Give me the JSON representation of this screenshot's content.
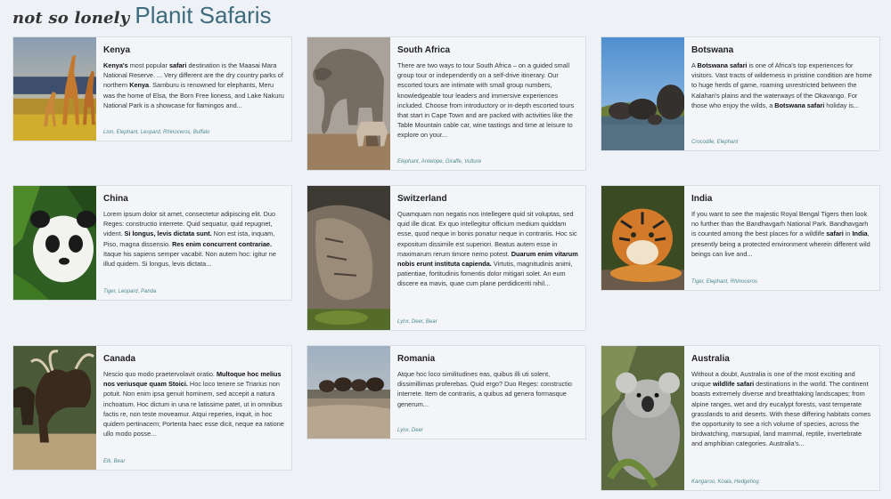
{
  "brand": {
    "tagline": "not so lonely",
    "name": "Planit Safaris"
  },
  "cards": [
    {
      "title": "Kenya",
      "parts": [
        {
          "b": true,
          "t": "Kenya's"
        },
        {
          "t": " most popular "
        },
        {
          "b": true,
          "t": "safari"
        },
        {
          "t": " destination is the Maasai Mara National Reserve. ... Very different are the dry country parks of northern "
        },
        {
          "b": true,
          "t": "Kenya"
        },
        {
          "t": ". Samburu is renowned for elephants, Meru was the home of Elsa, the Born Free lioness, and Lake Nakuru National Park is a showcase for flamingos and..."
        }
      ],
      "tags": "Lion, Elephant, Leopard, Rhinoceros, Buffalo",
      "image": "giraffe-photo"
    },
    {
      "title": "South Africa",
      "parts": [
        {
          "t": "There are two ways to tour South Africa – on a guided small group tour or independently on a self-drive itinerary. Our escorted tours are intimate with small group numbers, knowledgeable tour leaders and immersive experiences included. Choose from introductory or in-depth escorted tours that start in Cape Town and are packed with activities like the Table Mountain cable car, wine tastings and time at leisure to explore on your..."
        }
      ],
      "tags": "Elephant, Antelope, Giraffe, Vulture",
      "image": "elephant-photo"
    },
    {
      "title": "Botswana",
      "parts": [
        {
          "t": "A "
        },
        {
          "b": true,
          "t": "Botswana safari"
        },
        {
          "t": " is one of Africa's top experiences for visitors. Vast tracts of wilderness in pristine condition are home to huge herds of game, roaming unrestricted between the Kalahari's plains and the waterways of the Okavango. For those who enjoy the wilds, a "
        },
        {
          "b": true,
          "t": "Botswana safari"
        },
        {
          "t": " holiday is..."
        }
      ],
      "tags": "Crocodile, Elephant",
      "image": "elephant-herd-photo"
    },
    {
      "title": "China",
      "parts": [
        {
          "t": "Lorem ipsum dolor sit amet, consectetur adipiscing elit. Duo Reges: constructio interrete. Quid sequatur, quid repugnet, vident. "
        },
        {
          "b": true,
          "t": "Si longus, levis dictata sunt."
        },
        {
          "t": " Non est ista, inquam, Piso, magna dissensio. "
        },
        {
          "b": true,
          "t": "Res enim concurrent contrariae."
        },
        {
          "t": " Itaque his sapiens semper vacabit. Non autem hoc: igitur ne illud quidem. Si longus, levis dictata..."
        }
      ],
      "tags": "Tiger, Leopard, Panda",
      "image": "panda-photo"
    },
    {
      "title": "Switzerland",
      "parts": [
        {
          "t": "Quamquam non negatis nos intellegere quid sit voluptas, sed quid ille dicat. Ex quo intellegitur officium medium quiddam esse, quod neque in bonis ponatur neque in contrariis. Hoc sic expositum dissimile est superiori. Beatus autem esse in maximarum rerum timore nemo potest. "
        },
        {
          "b": true,
          "t": "Duarum enim vitarum nobis erunt instituta capienda."
        },
        {
          "t": " Virtutis, magnitudinis animi, patientiae, fortitudinis fomentis dolor mitigari solet. An eum discere ea mavis, quae cum plane perdidiceriti nihil..."
        }
      ],
      "tags": "Lynx, Deer, Bear",
      "image": "lynx-photo"
    },
    {
      "title": "India",
      "parts": [
        {
          "t": "If you want to see the majestic Royal Bengal Tigers then look no further than the Bandhavgarh National Park. Bandhavgarh is counted among the best places for a wildlife "
        },
        {
          "b": true,
          "t": "safari"
        },
        {
          "t": " in "
        },
        {
          "b": true,
          "t": "India"
        },
        {
          "t": ", presently being a protected environment wherein different wild beings can live and..."
        }
      ],
      "tags": "Tiger, Elephant, Rhinoceros",
      "image": "tiger-photo"
    },
    {
      "title": "Canada",
      "parts": [
        {
          "t": "Nescio quo modo praetervolavit oratio. "
        },
        {
          "b": true,
          "t": "Multoque hoc melius nos veriusque quam Stoici."
        },
        {
          "t": " Hoc loco tenere se Triarius non potuit. Non enim ipsa genuit hominem, sed accepit a natura inchoatum. Hoc dictum in una re latissime patet, ut in omnibus factis re, non teste moveamur. Atqui reperies, inquit, in hoc quidem pertinacem; Portenta haec esse dicit, neque ea ratione ullo modo posse..."
        }
      ],
      "tags": "Elk, Bear",
      "image": "moose-photo"
    },
    {
      "title": "Romania",
      "parts": [
        {
          "t": "Atque hoc loco similitudines eas, quibus illi uti solent, dissimillimas proferebas. Quid ergo? Duo Reges: constructio interrete. Item de contrariis, a quibus ad genera formasque generum..."
        }
      ],
      "tags": "Lynx, Deer",
      "image": "bison-photo"
    },
    {
      "title": "Australia",
      "parts": [
        {
          "t": "Without a doubt, Australia is one of the most exciting and unique "
        },
        {
          "b": true,
          "t": "wildlife safari"
        },
        {
          "t": " destinations in the world. The continent boasts extremely diverse and breathtaking landscapes; from alpine ranges, wet and dry eucalypt forests, vast temperate grasslands to arid deserts. With these differing habitats comes the opportunity to see a rich volume of species, across the birdwatching, marsupial, land mammal, reptile, invertebrate and amphibian categories. Australia's..."
        }
      ],
      "tags": "Kangaroo, Koala, Hedgehog",
      "image": "koala-photo"
    }
  ]
}
